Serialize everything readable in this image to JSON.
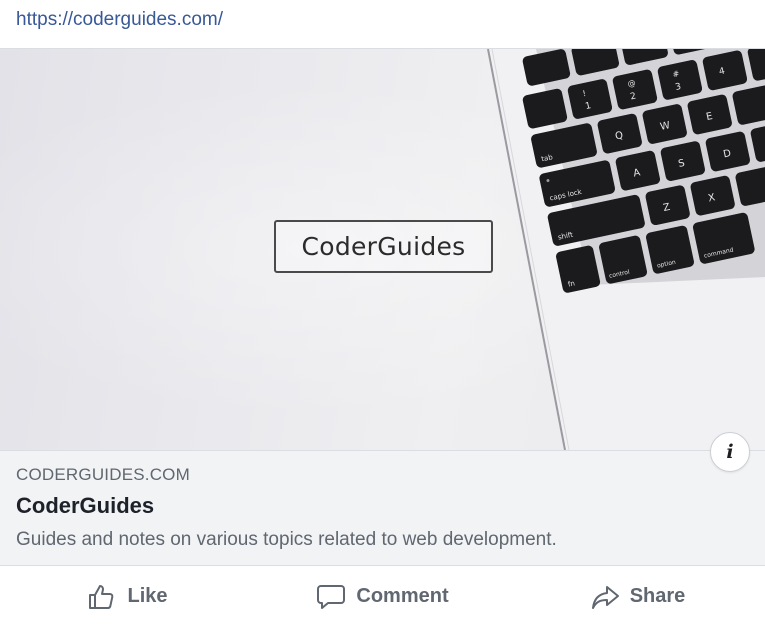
{
  "url_bar": {
    "url": "https://coderguides.com/"
  },
  "preview": {
    "logo_text": "CoderGuides"
  },
  "keys": {
    "row1": [
      "!",
      "1",
      "@",
      "2",
      "#",
      "3",
      "4"
    ],
    "row2": [
      "tab",
      "Q",
      "W",
      "E"
    ],
    "row3": [
      "caps lock",
      "A",
      "S",
      "D"
    ],
    "row4": [
      "shift",
      "Z",
      "X"
    ],
    "row5": [
      "fn",
      "control",
      "option",
      "command"
    ]
  },
  "info_button": {
    "glyph": "i"
  },
  "link_meta": {
    "domain": "CODERGUIDES.COM",
    "title": "CoderGuides",
    "description": "Guides and notes on various topics related to web development."
  },
  "actions": {
    "like": {
      "label": "Like",
      "icon": "thumbs-up-icon"
    },
    "comment": {
      "label": "Comment",
      "icon": "speech-bubble-icon"
    },
    "share": {
      "label": "Share",
      "icon": "share-arrow-icon"
    }
  },
  "colors": {
    "link": "#385898",
    "muted": "#606770",
    "card_bg": "#f2f3f5"
  }
}
